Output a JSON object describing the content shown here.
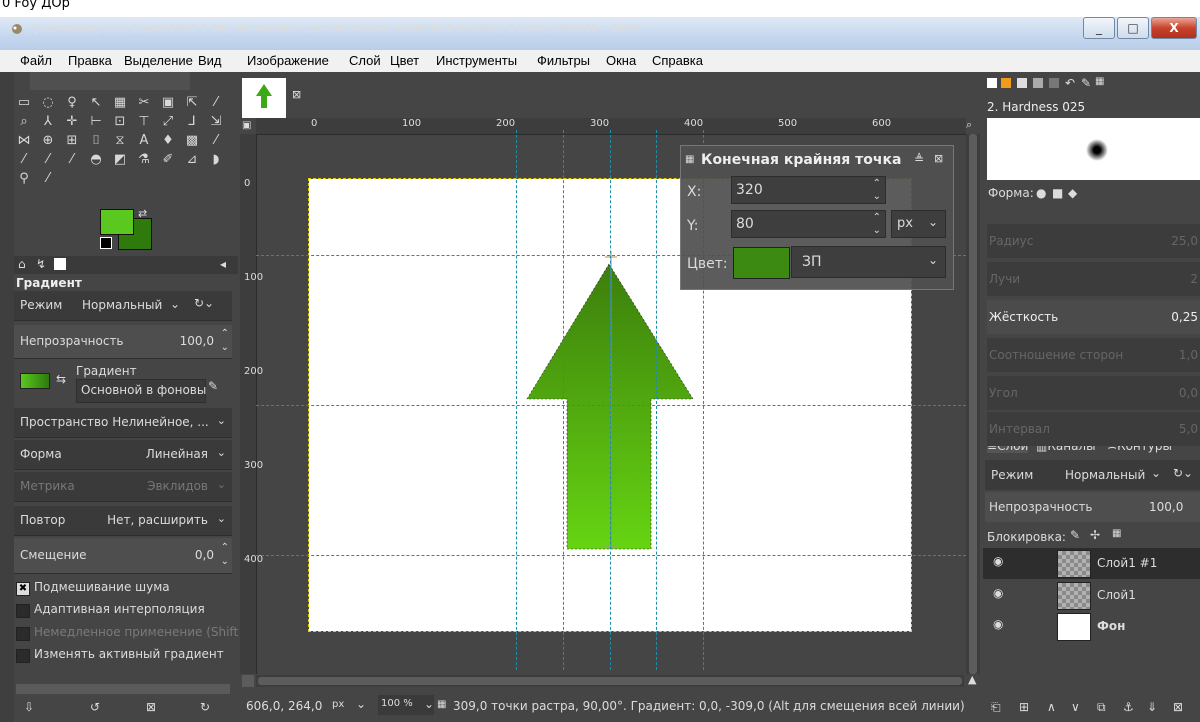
{
  "top_strip_text": "0 Foy ДОр",
  "window": {
    "title": "*[Без имени]-13.0 (Цвета RGB 8 бит, нелинейное целочисленное, GIMP built-in sRGB, 3 слоя) 640x480 – GIMP",
    "minimize": "_",
    "maximize": "□",
    "close": "X"
  },
  "menu": [
    "Файл",
    "Правка",
    "Выделение",
    "Вид",
    "Изображение",
    "Слой",
    "Цвет",
    "Инструменты",
    "Фильтры",
    "Окна",
    "Справка"
  ],
  "tool_options": {
    "title": "Градиент",
    "mode_label": "Режим",
    "mode_value": "Нормальный",
    "opacity_label": "Непрозрачность",
    "opacity_value": "100,0",
    "gradient_label": "Градиент",
    "gradient_value": "Основной в фоновы",
    "space_label": "Пространство Нелинейное, ...",
    "shape_label": "Форма",
    "shape_value": "Линейная",
    "metric_label": "Метрика",
    "metric_value": "Эвклидов",
    "repeat_label": "Повтор",
    "repeat_value": "Нет, расширить",
    "offset_label": "Смещение",
    "offset_value": "0,0",
    "checks": [
      "Подмешивание шума",
      "Адаптивная интерполяция",
      "Немедленное применение (Shift)",
      "Изменять активный градиент"
    ]
  },
  "ruler_marks": [
    "0",
    "100",
    "200",
    "300",
    "400",
    "500",
    "600"
  ],
  "vruler_marks": [
    "0",
    "100",
    "200",
    "300",
    "400"
  ],
  "endpoint_dialog": {
    "title": "Конечная крайняя точка",
    "x_label": "X:",
    "x_value": "320",
    "y_label": "Y:",
    "y_value": "80",
    "unit": "px",
    "color_label": "Цвет:",
    "color_value": "ЗП"
  },
  "status": {
    "coords": "606,0, 264,0",
    "unit": "px",
    "zoom": "100 %",
    "message": "309,0 точки растра, 90,00°. Градиент: 0,0, -309,0 (Alt для смещения всей линии)"
  },
  "brushes": {
    "name": "2. Hardness 025",
    "shape_label": "Форма:",
    "props": [
      {
        "label": "Радиус",
        "value": "25,0"
      },
      {
        "label": "Лучи",
        "value": "2"
      },
      {
        "label": "Жёсткость",
        "value": "0,25"
      },
      {
        "label": "Соотношение сторон",
        "value": "1,0"
      },
      {
        "label": "Угол",
        "value": "0,0"
      },
      {
        "label": "Интервал",
        "value": "5,0"
      }
    ]
  },
  "layers_panel": {
    "tabs": [
      "Слои",
      "Каналы",
      "Контуры"
    ],
    "mode_label": "Режим",
    "mode_value": "Нормальный",
    "opacity_label": "Непрозрачность",
    "opacity_value": "100,0",
    "lock_label": "Блокировка:",
    "layers": [
      {
        "name": "Слой1 #1"
      },
      {
        "name": "Слой1"
      },
      {
        "name": "Фон"
      }
    ]
  },
  "colors": {
    "foreground": "#5ac81e",
    "background": "#2e7a0c",
    "arrow_top": "#3c7e0c",
    "arrow_bottom": "#66d412",
    "guide": "#1d8fae"
  }
}
